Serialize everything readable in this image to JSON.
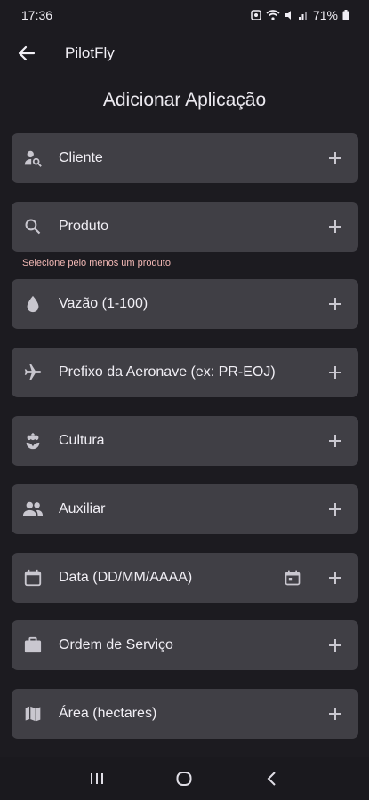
{
  "status": {
    "time": "17:36",
    "battery": "71%"
  },
  "app": {
    "title": "PilotFly",
    "back_icon": "arrow-back-icon"
  },
  "page": {
    "title": "Adicionar Aplicação"
  },
  "fields": {
    "cliente": {
      "label": "Cliente",
      "icon": "person-search-icon"
    },
    "produto": {
      "label": "Produto",
      "icon": "search-icon",
      "error": "Selecione pelo menos um produto"
    },
    "vazao": {
      "label": "Vazão (1-100)",
      "icon": "water-drop-icon"
    },
    "prefixo": {
      "label": "Prefixo da Aeronave (ex: PR-EOJ)",
      "icon": "airplane-icon"
    },
    "cultura": {
      "label": "Cultura",
      "icon": "plant-icon"
    },
    "auxiliar": {
      "label": "Auxiliar",
      "icon": "group-icon"
    },
    "data": {
      "label": "Data (DD/MM/AAAA)",
      "icon": "calendar-icon"
    },
    "ordem": {
      "label": "Ordem de Serviço",
      "icon": "briefcase-icon"
    },
    "area": {
      "label": "Área (hectares)",
      "icon": "map-icon"
    }
  },
  "colors": {
    "background": "#1c1b20",
    "field": "#403f45",
    "error": "#f2b8b5"
  }
}
